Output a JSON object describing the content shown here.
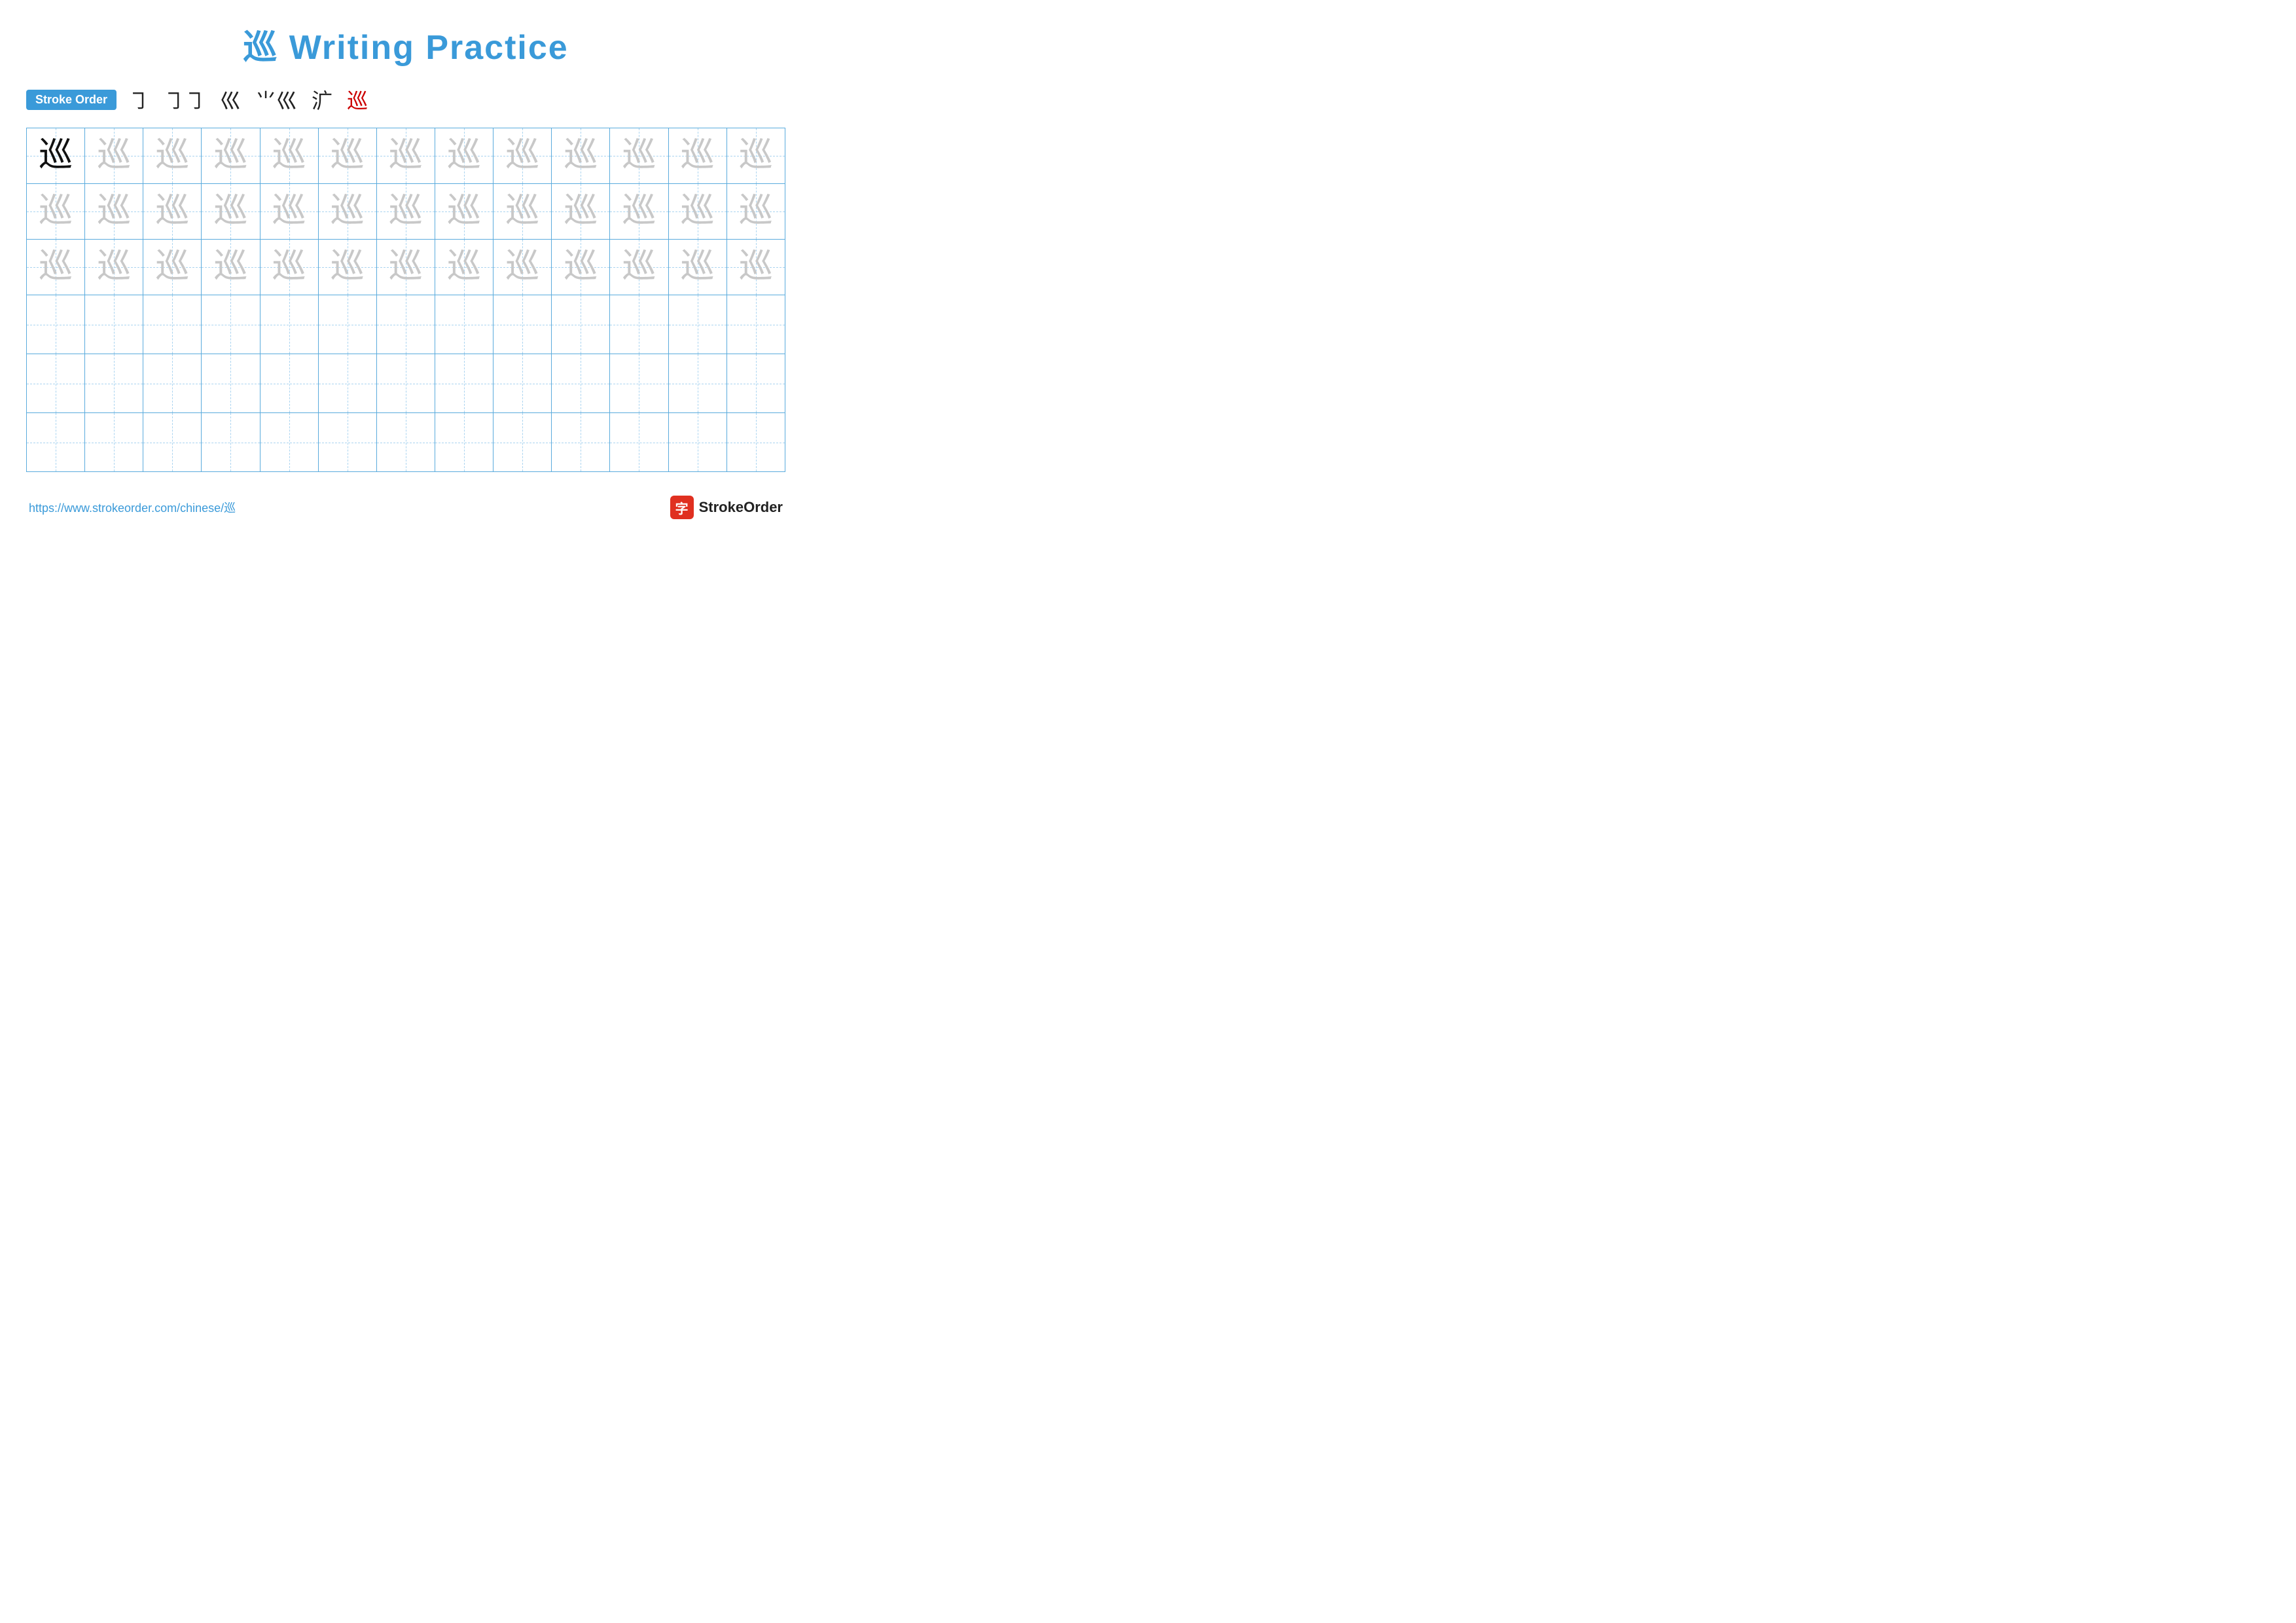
{
  "title": {
    "char": "巡",
    "text": "Writing Practice",
    "full": "巡 Writing Practice"
  },
  "stroke_order": {
    "badge_label": "Stroke Order",
    "strokes": [
      "㇆",
      "㇆㇆",
      "巛",
      "⺌巛",
      "㲿巛",
      "巡"
    ]
  },
  "grid": {
    "rows": 6,
    "cols": 13,
    "practice_char": "巡",
    "faded_rows": 3,
    "empty_rows": 3
  },
  "footer": {
    "url": "https://www.strokeorder.com/chinese/巡",
    "brand_icon": "字",
    "brand_name": "StrokeOrder"
  }
}
